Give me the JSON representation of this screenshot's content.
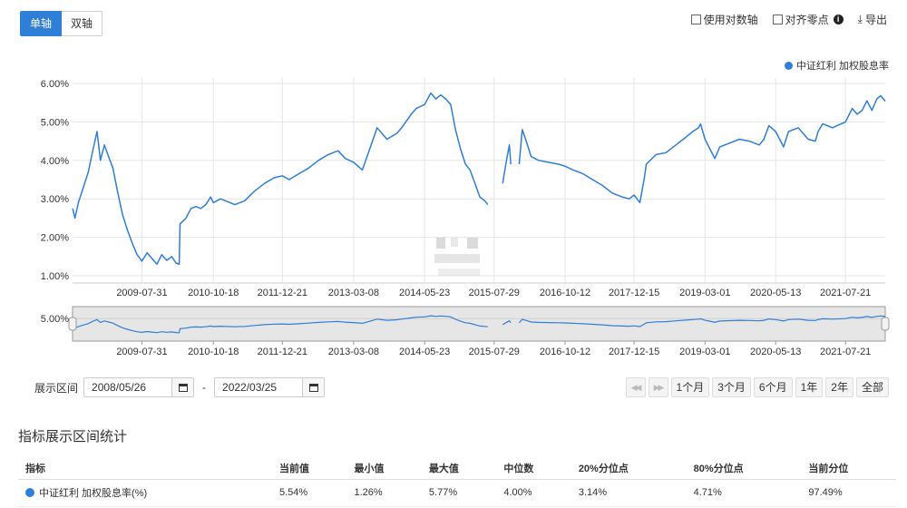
{
  "toggle": {
    "single": "单轴",
    "dual": "双轴"
  },
  "options": {
    "log_axis": "使用对数轴",
    "align_zero": "对齐零点",
    "export": "导出"
  },
  "colors": {
    "series": "#2f7ed8",
    "navigator_fill": "#e6e6e6"
  },
  "range": {
    "label": "展示区间",
    "start": "2008/05/26",
    "separator": "-",
    "end": "2022/03/25"
  },
  "periods": [
    "1个月",
    "3个月",
    "6个月",
    "1年",
    "2年",
    "全部"
  ],
  "stats": {
    "title": "指标展示区间统计",
    "headers": [
      "指标",
      "当前值",
      "最小值",
      "最大值",
      "中位数",
      "20%分位点",
      "80%分位点",
      "当前分位"
    ],
    "rows": [
      {
        "name": "中证红利 加权股息率(%)",
        "values": [
          "5.54%",
          "1.26%",
          "5.77%",
          "4.00%",
          "3.14%",
          "4.71%",
          "97.49%"
        ]
      }
    ]
  },
  "chart_data": {
    "type": "line",
    "legend": "中证红利 加权股息率",
    "legend_position": "top-right",
    "y_ticks": [
      "1.00%",
      "2.00%",
      "3.00%",
      "4.00%",
      "5.00%",
      "6.00%"
    ],
    "ylim": [
      1,
      6.15
    ],
    "x_ticks": [
      "2009-07-31",
      "2010-10-18",
      "2011-12-21",
      "2013-03-08",
      "2014-05-23",
      "2015-07-29",
      "2016-10-12",
      "2017-12-15",
      "2019-03-01",
      "2020-05-13",
      "2021-07-21"
    ],
    "xlim": [
      "2008-05-26",
      "2022-03-25"
    ],
    "grid": true,
    "navigator_y_tick": "5.00%",
    "series": [
      {
        "name": "中证红利 加权股息率",
        "segments": [
          [
            [
              "2008-05-26",
              2.75
            ],
            [
              "2008-06-10",
              2.5
            ],
            [
              "2008-07-01",
              2.9
            ],
            [
              "2008-08-01",
              3.3
            ],
            [
              "2008-09-01",
              3.7
            ],
            [
              "2008-10-01",
              4.3
            ],
            [
              "2008-10-25",
              4.75
            ],
            [
              "2008-11-15",
              4.0
            ],
            [
              "2008-12-10",
              4.4
            ],
            [
              "2009-01-05",
              4.1
            ],
            [
              "2009-02-01",
              3.8
            ],
            [
              "2009-03-01",
              3.2
            ],
            [
              "2009-04-01",
              2.6
            ],
            [
              "2009-05-01",
              2.2
            ],
            [
              "2009-06-01",
              1.85
            ],
            [
              "2009-07-01",
              1.55
            ],
            [
              "2009-07-31",
              1.38
            ],
            [
              "2009-09-01",
              1.6
            ],
            [
              "2009-10-01",
              1.45
            ],
            [
              "2009-11-01",
              1.3
            ],
            [
              "2009-12-01",
              1.55
            ],
            [
              "2010-01-01",
              1.4
            ],
            [
              "2010-02-01",
              1.5
            ],
            [
              "2010-03-01",
              1.33
            ],
            [
              "2010-03-20",
              1.3
            ],
            [
              "2010-03-25",
              2.35
            ],
            [
              "2010-05-01",
              2.5
            ],
            [
              "2010-06-01",
              2.75
            ],
            [
              "2010-07-01",
              2.8
            ],
            [
              "2010-08-01",
              2.75
            ],
            [
              "2010-09-01",
              2.85
            ],
            [
              "2010-10-01",
              3.05
            ],
            [
              "2010-10-18",
              2.9
            ],
            [
              "2010-12-01",
              3.0
            ],
            [
              "2011-01-01",
              2.95
            ],
            [
              "2011-03-01",
              2.85
            ],
            [
              "2011-05-01",
              2.95
            ],
            [
              "2011-07-01",
              3.2
            ],
            [
              "2011-09-01",
              3.4
            ],
            [
              "2011-11-01",
              3.55
            ],
            [
              "2011-12-21",
              3.6
            ],
            [
              "2012-02-01",
              3.5
            ],
            [
              "2012-04-01",
              3.65
            ],
            [
              "2012-06-01",
              3.8
            ],
            [
              "2012-08-01",
              4.0
            ],
            [
              "2012-10-01",
              4.15
            ],
            [
              "2012-12-01",
              4.25
            ],
            [
              "2013-01-15",
              4.05
            ],
            [
              "2013-03-08",
              3.95
            ],
            [
              "2013-05-01",
              3.75
            ],
            [
              "2013-06-20",
              4.35
            ],
            [
              "2013-08-01",
              4.85
            ],
            [
              "2013-10-01",
              4.55
            ],
            [
              "2013-12-01",
              4.7
            ],
            [
              "2014-01-01",
              4.85
            ],
            [
              "2014-03-01",
              5.2
            ],
            [
              "2014-04-01",
              5.35
            ],
            [
              "2014-05-23",
              5.45
            ],
            [
              "2014-07-01",
              5.75
            ],
            [
              "2014-08-01",
              5.6
            ],
            [
              "2014-09-01",
              5.7
            ],
            [
              "2014-10-01",
              5.6
            ],
            [
              "2014-11-01",
              5.45
            ],
            [
              "2014-12-01",
              4.8
            ],
            [
              "2015-01-01",
              4.3
            ],
            [
              "2015-02-01",
              3.9
            ],
            [
              "2015-03-01",
              3.75
            ],
            [
              "2015-04-01",
              3.4
            ],
            [
              "2015-05-01",
              3.05
            ],
            [
              "2015-06-01",
              2.95
            ],
            [
              "2015-06-20",
              2.85
            ]
          ],
          [
            [
              "2015-09-20",
              3.4
            ],
            [
              "2015-10-10",
              3.9
            ],
            [
              "2015-11-01",
              4.4
            ],
            [
              "2015-11-10",
              3.9
            ]
          ],
          [
            [
              "2016-01-01",
              3.9
            ],
            [
              "2016-01-20",
              4.8
            ],
            [
              "2016-02-10",
              4.55
            ],
            [
              "2016-03-15",
              4.1
            ],
            [
              "2016-05-01",
              4.0
            ],
            [
              "2016-07-01",
              3.95
            ],
            [
              "2016-09-01",
              3.9
            ],
            [
              "2016-10-12",
              3.85
            ],
            [
              "2016-12-01",
              3.75
            ],
            [
              "2017-02-01",
              3.65
            ],
            [
              "2017-04-01",
              3.5
            ],
            [
              "2017-06-01",
              3.35
            ],
            [
              "2017-08-01",
              3.15
            ],
            [
              "2017-10-01",
              3.05
            ],
            [
              "2017-11-15",
              3.0
            ],
            [
              "2017-12-15",
              3.1
            ],
            [
              "2018-01-20",
              2.9
            ],
            [
              "2018-02-15",
              3.5
            ],
            [
              "2018-03-01",
              3.9
            ],
            [
              "2018-05-01",
              4.15
            ],
            [
              "2018-07-01",
              4.2
            ],
            [
              "2018-09-01",
              4.4
            ],
            [
              "2018-11-01",
              4.6
            ],
            [
              "2018-12-15",
              4.75
            ],
            [
              "2019-01-20",
              4.85
            ],
            [
              "2019-02-01",
              4.95
            ],
            [
              "2019-03-01",
              4.55
            ],
            [
              "2019-03-25",
              4.35
            ],
            [
              "2019-05-01",
              4.05
            ],
            [
              "2019-06-01",
              4.35
            ],
            [
              "2019-08-01",
              4.45
            ],
            [
              "2019-10-01",
              4.55
            ],
            [
              "2019-12-01",
              4.5
            ],
            [
              "2020-02-01",
              4.4
            ],
            [
              "2020-03-01",
              4.55
            ],
            [
              "2020-04-01",
              4.9
            ],
            [
              "2020-05-13",
              4.75
            ],
            [
              "2020-07-01",
              4.35
            ],
            [
              "2020-08-01",
              4.75
            ],
            [
              "2020-10-01",
              4.85
            ],
            [
              "2020-12-01",
              4.55
            ],
            [
              "2021-01-15",
              4.5
            ],
            [
              "2021-02-01",
              4.75
            ],
            [
              "2021-03-01",
              4.95
            ],
            [
              "2021-05-01",
              4.85
            ],
            [
              "2021-07-21",
              5.0
            ],
            [
              "2021-09-01",
              5.35
            ],
            [
              "2021-10-01",
              5.2
            ],
            [
              "2021-11-01",
              5.3
            ],
            [
              "2021-12-01",
              5.55
            ],
            [
              "2022-01-01",
              5.3
            ],
            [
              "2022-02-01",
              5.6
            ],
            [
              "2022-02-25",
              5.68
            ],
            [
              "2022-03-25",
              5.54
            ]
          ]
        ]
      }
    ]
  }
}
